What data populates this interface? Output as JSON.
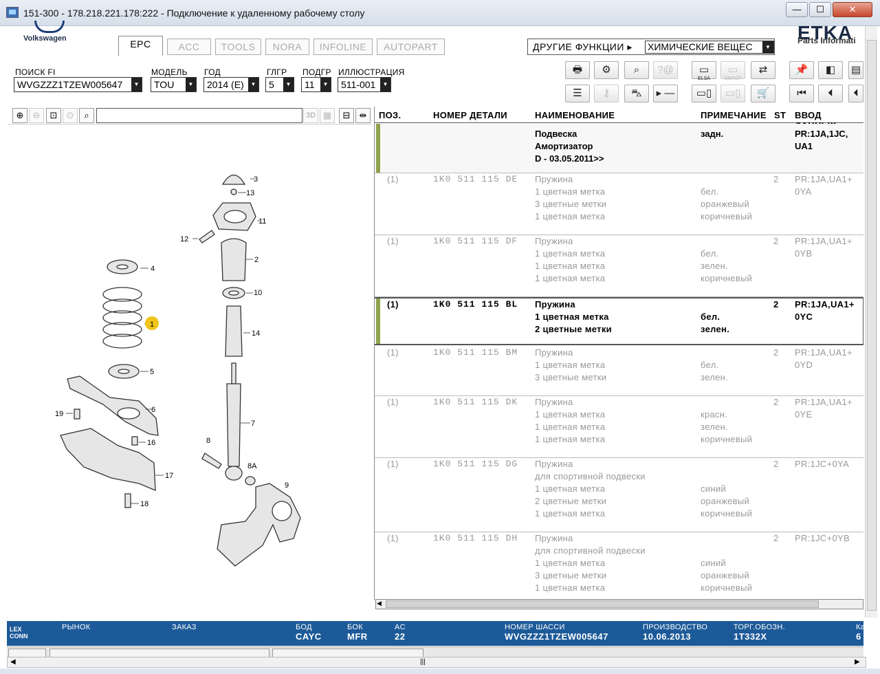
{
  "window": {
    "title": "151-300 - 178.218.221.178:222 - Подключение к удаленному рабочему столу",
    "min": "—",
    "max": "☐",
    "close": "✕"
  },
  "header": {
    "brand": "Volkswagen",
    "etka_logo": "ETKA",
    "etka_sub": "Parts Informati",
    "tabs": [
      "EPC",
      "ACC",
      "TOOLS",
      "NORA",
      "INFOLINE",
      "AUTOPART"
    ],
    "other_label": "ДРУГИЕ ФУНКЦИИ ▸",
    "other_value": "ХИМИЧЕСКИЕ ВЕЩЕС"
  },
  "filters": {
    "fi_label": "ПОИСК FI",
    "fi_value": "WVGZZZ1TZEW005647",
    "model_label": "МОДЕЛЬ",
    "model_value": "TOU",
    "year_label": "ГОД",
    "year_value": "2014 (E)",
    "mg_label": "ГЛГР",
    "mg_value": "5",
    "sg_label": "ПОДГР",
    "sg_value": "11",
    "ill_label": "ИЛЛЮСТРАЦИЯ",
    "ill_value": "511-001"
  },
  "toolbar": {
    "elsa": "ELSA",
    "depot": "DEPOT"
  },
  "image_tools": {
    "label_3d": "3D"
  },
  "diagram_labels": [
    "3",
    "13",
    "11",
    "12",
    "2",
    "10",
    "4",
    "1",
    "14",
    "5",
    "6",
    "19",
    "7",
    "16",
    "17",
    "8",
    "8A",
    "9",
    "18"
  ],
  "table": {
    "headers": {
      "pos": "ПОЗ.",
      "part": "НОМЕР ДЕТАЛИ",
      "name": "НАИМЕНОВАНИЕ",
      "note": "ПРИМЕЧАНИЕ",
      "st": "ST",
      "input": "ВВОД ДАННЫХ"
    },
    "group": {
      "names": [
        "Подвеска",
        "Амортизатор",
        "D - 03.05.2011>>"
      ],
      "note": "задн.",
      "input": [
        "PR:1JA,1JC,",
        "UA1"
      ]
    },
    "rows": [
      {
        "pos": "(1)",
        "part": "1K0 511 115 DE",
        "names": [
          "Пружина",
          "1 цветная метка",
          "3 цветные метки",
          "1 цветная метка"
        ],
        "notes": [
          "",
          "бел.",
          "оранжевый",
          "коричневый"
        ],
        "st": "2",
        "input": [
          "PR:1JA,UA1+",
          "0YA"
        ]
      },
      {
        "pos": "(1)",
        "part": "1K0 511 115 DF",
        "names": [
          "Пружина",
          "1 цветная метка",
          "1 цветная метка",
          "1 цветная метка"
        ],
        "notes": [
          "",
          "бел.",
          "зелен.",
          "коричневый"
        ],
        "st": "2",
        "input": [
          "PR:1JA,UA1+",
          "0YB"
        ]
      },
      {
        "pos": "(1)",
        "part": "1K0 511 115 BL",
        "names": [
          "Пружина",
          "1 цветная метка",
          "2 цветные метки"
        ],
        "notes": [
          "",
          "бел.",
          "зелен."
        ],
        "st": "2",
        "input": [
          "PR:1JA,UA1+",
          "0YC"
        ]
      },
      {
        "pos": "(1)",
        "part": "1K0 511 115 BM",
        "names": [
          "Пружина",
          "1 цветная метка",
          "3 цветные метки"
        ],
        "notes": [
          "",
          "бел.",
          "зелен."
        ],
        "st": "2",
        "input": [
          "PR:1JA,UA1+",
          "0YD"
        ]
      },
      {
        "pos": "(1)",
        "part": "1K0 511 115 DK",
        "names": [
          "Пружина",
          "1 цветная метка",
          "1 цветная метка",
          "1 цветная метка"
        ],
        "notes": [
          "",
          "красн.",
          "зелен.",
          "коричневый"
        ],
        "st": "2",
        "input": [
          "PR:1JA,UA1+",
          "0YE"
        ]
      },
      {
        "pos": "(1)",
        "part": "1K0 511 115 DG",
        "names": [
          "Пружина",
          "для спортивной подвески",
          "1 цветная метка",
          "2 цветные метки",
          "1 цветная метка"
        ],
        "notes": [
          "",
          "",
          "синий",
          "оранжевый",
          "коричневый"
        ],
        "st": "2",
        "input": [
          "PR:1JC+0YA"
        ]
      },
      {
        "pos": "(1)",
        "part": "1K0 511 115 DH",
        "names": [
          "Пружина",
          "для спортивной подвески",
          "1 цветная метка",
          "3 цветные метки",
          "1 цветная метка"
        ],
        "notes": [
          "",
          "",
          "синий",
          "оранжевый",
          "коричневый"
        ],
        "st": "2",
        "input": [
          "PR:1JC+0YB"
        ]
      }
    ]
  },
  "status": {
    "logo": "LEX CONN",
    "market_label": "РЫНОК",
    "order_label": "ЗАКАЗ",
    "bod_label": "БОД",
    "bod_value": "CAYC",
    "bok_label": "БОК",
    "bok_value": "MFR",
    "ac_label": "AC",
    "ac_value": "22",
    "chassis_label": "НОМЕР ШАССИ",
    "chassis_value": "WVGZZZ1TZEW005647",
    "prod_label": "ПРОИЗВОДСТВО",
    "prod_value": "10.06.2013",
    "trade_label": "ТОРГ.ОБОЗН.",
    "trade_value": "1T332X",
    "cut_label": "Ка",
    "cut_value": "6"
  },
  "colors": {
    "status_bg": "#1d5a99",
    "accent_bar": "#8fa34c",
    "callout": "#f0c419"
  }
}
